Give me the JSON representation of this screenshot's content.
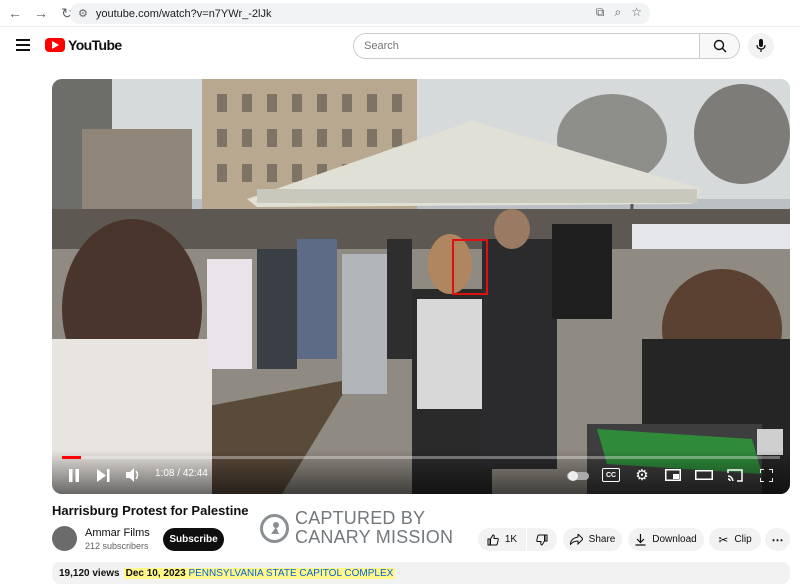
{
  "browser": {
    "url": "youtube.com/watch?v=n7YWr_-2lJk"
  },
  "header": {
    "logo_text": "YouTube",
    "search_placeholder": "Search"
  },
  "player": {
    "time_current": "1:08",
    "time_separator": "/",
    "time_total": "42:44",
    "progress_fraction": 0.026,
    "cc_label": "CC"
  },
  "video": {
    "title": "Harrisburg Protest for Palestine",
    "channel_name": "Ammar Films",
    "subscribers": "212 subscribers",
    "subscribe_label": "Subscribe",
    "like_count": "1K",
    "share_label": "Share",
    "download_label": "Download",
    "clip_label": "Clip",
    "more_label": "⋯",
    "views": "19,120 views",
    "date": "Dec 10, 2023",
    "location_tag": "PENNSYLVANIA STATE CAPITOL COMPLEX"
  },
  "watermark": {
    "line1": "CAPTURED BY",
    "line2": "CANARY MISSION"
  },
  "colors": {
    "brand_red": "#ff0000",
    "highlight": "#fff98a",
    "annotation_box": "#e01010"
  }
}
